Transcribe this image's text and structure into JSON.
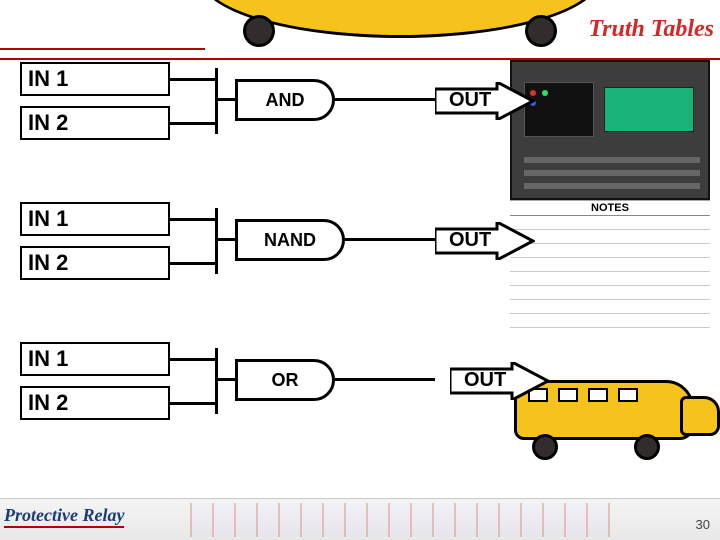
{
  "title": "Truth Tables",
  "gates": [
    {
      "in1": "IN 1",
      "in2": "IN 2",
      "op": "AND",
      "out": "OUT"
    },
    {
      "in1": "IN 1",
      "in2": "IN 2",
      "op": "NAND",
      "out": "OUT"
    },
    {
      "in1": "IN 1",
      "in2": "IN 2",
      "op": "OR",
      "out": "OUT"
    }
  ],
  "notes_header": "NOTES",
  "footer": {
    "brand": "Protective Relay",
    "page": "30"
  }
}
